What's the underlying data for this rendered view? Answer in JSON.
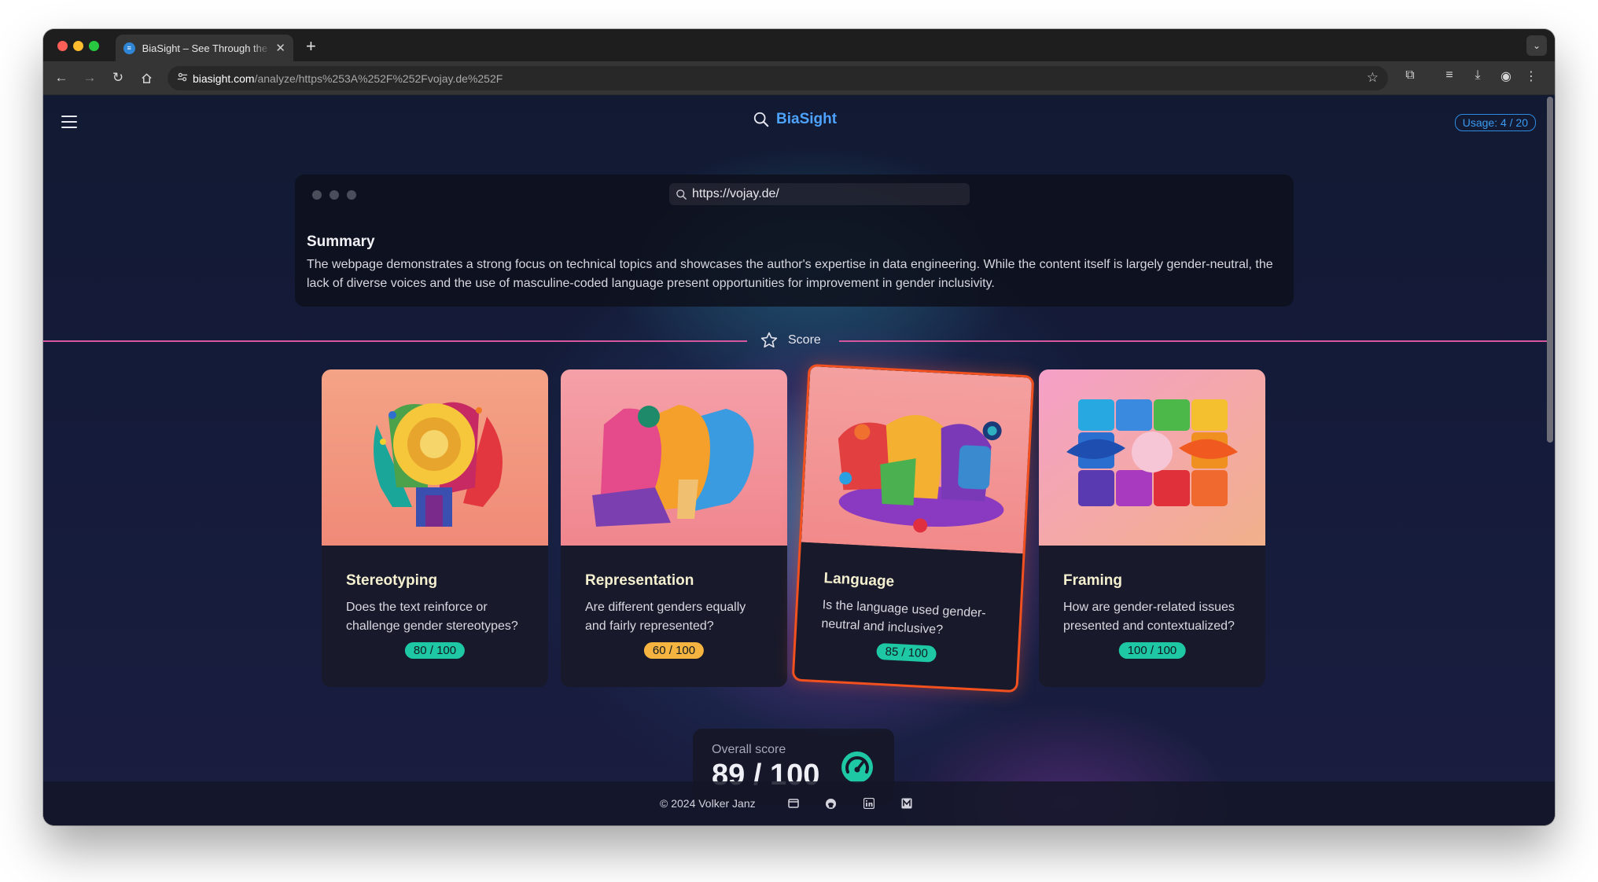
{
  "browser": {
    "tab_title": "BiaSight – See Through the Bias",
    "tab_favicon": "≡",
    "url_host": "biasight.com",
    "url_path": "/analyze/https%253A%252F%252Fvojay.de%252F",
    "new_tab_icon": "plus-icon",
    "close_tab_icon": "close-icon"
  },
  "header": {
    "brand": "BiaSight",
    "usage": "Usage: 4 / 20"
  },
  "summary": {
    "url": "https://vojay.de/",
    "title": "Summary",
    "body": "The webpage demonstrates a strong focus on technical topics and showcases the author's expertise in data engineering. While the content itself is largely gender-neutral, the lack of diverse voices and the use of masculine-coded language present opportunities for improvement in gender inclusivity."
  },
  "score_section": {
    "label": "Score"
  },
  "cards": [
    {
      "title": "Stereotyping",
      "description": "Does the text reinforce or challenge gender stereotypes?",
      "score": "80 / 100",
      "score_color": "#1fc8a4"
    },
    {
      "title": "Representation",
      "description": "Are different genders equally and fairly represented?",
      "score": "60 / 100",
      "score_color": "#f5b440"
    },
    {
      "title": "Language",
      "description": "Is the language used gender-neutral and inclusive?",
      "score": "85 / 100",
      "score_color": "#1fc8a4"
    },
    {
      "title": "Framing",
      "description": "How are gender-related issues presented and contextualized?",
      "score": "100 / 100",
      "score_color": "#1fc8a4"
    }
  ],
  "overall": {
    "label": "Overall score",
    "value": "89 / 100"
  },
  "footer": {
    "copyright": "© 2024 Volker Janz",
    "icons": [
      "window-icon",
      "github-icon",
      "linkedin-icon",
      "medium-icon"
    ]
  },
  "colors": {
    "brand": "#4da3ff",
    "divider": "#d6579d",
    "featured_border": "#f2501e",
    "teal": "#1fc8a4",
    "amber": "#f5b440"
  }
}
